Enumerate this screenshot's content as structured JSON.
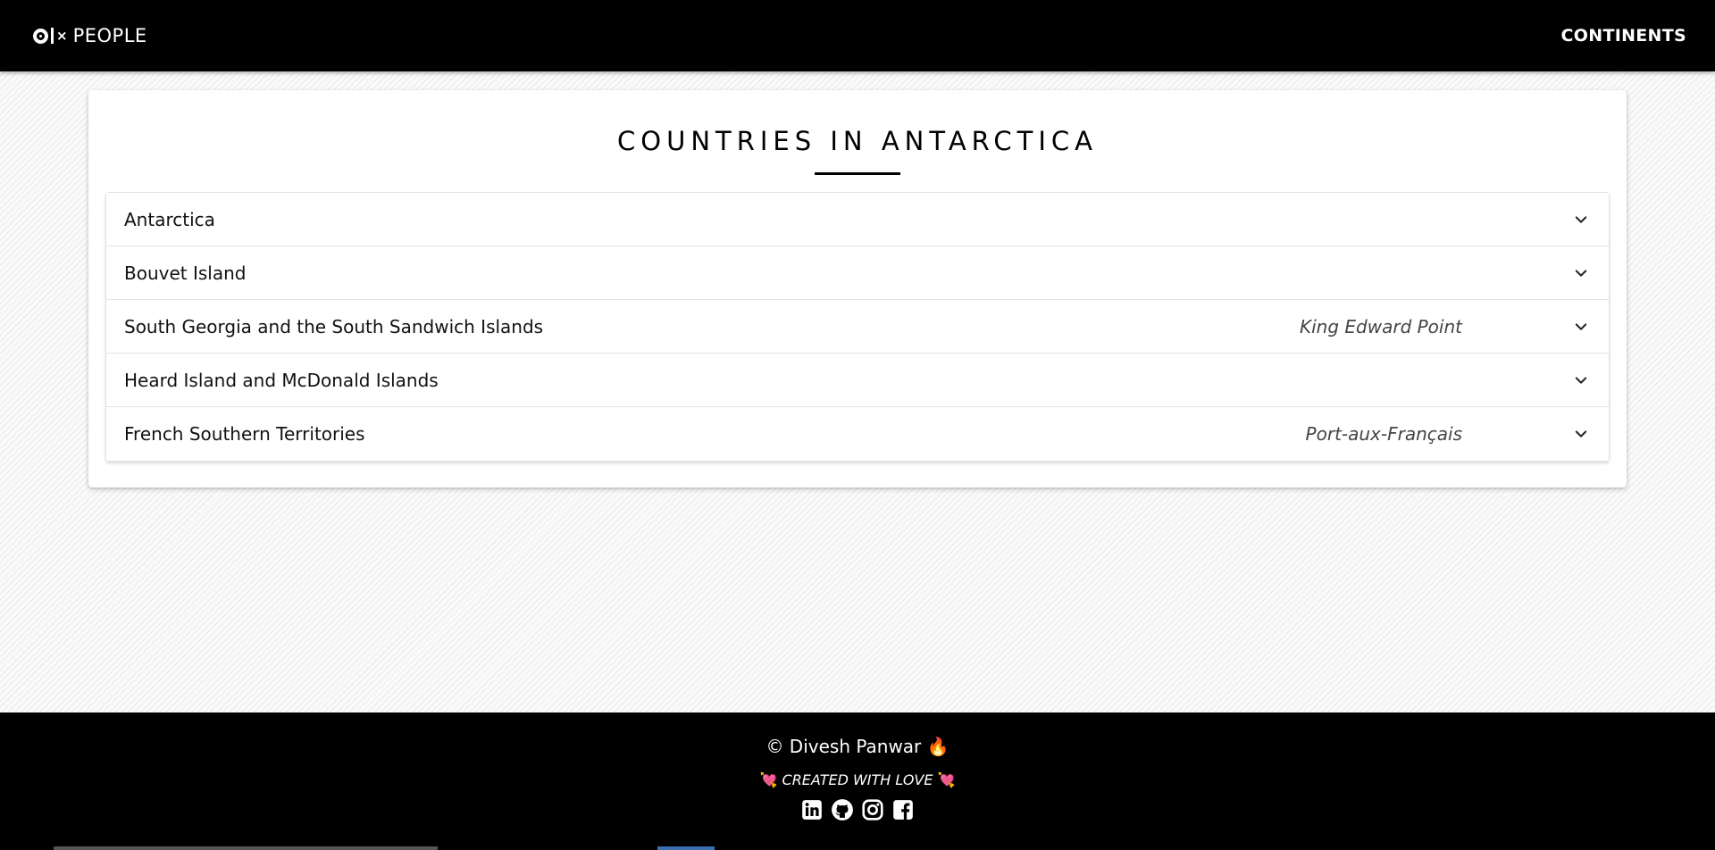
{
  "header": {
    "brand_text": "PEOPLE",
    "brand_mark_x": "×",
    "nav_continents": "CONTINENTS"
  },
  "main": {
    "title": "COUNTRIES IN ANTARCTICA",
    "countries": [
      {
        "name": "Antarctica",
        "capital": ""
      },
      {
        "name": "Bouvet Island",
        "capital": ""
      },
      {
        "name": "South Georgia and the South Sandwich Islands",
        "capital": "King Edward Point"
      },
      {
        "name": "Heard Island and McDonald Islands",
        "capital": ""
      },
      {
        "name": "French Southern Territories",
        "capital": "Port-aux-Français"
      }
    ]
  },
  "footer": {
    "copyright": "© Divesh Panwar",
    "fire": "🔥",
    "created": "CREATED WITH LOVE",
    "heart": "💘",
    "social": [
      "linkedin-icon",
      "github-icon",
      "instagram-icon",
      "facebook-icon"
    ]
  },
  "colors": {
    "header_bg": "#000000",
    "footer_bg": "#000000",
    "card_bg": "#ffffff"
  }
}
